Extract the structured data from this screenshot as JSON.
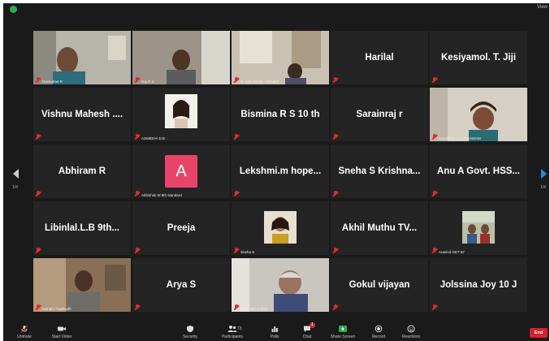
{
  "window": {
    "view_label": "View"
  },
  "colors": {
    "speaking_outline": "#b6d33a",
    "muted": "#e02b2b",
    "end": "#d6222a",
    "share_green": "#2fae4c",
    "avatar_pink": "#e8446a"
  },
  "pages": {
    "left": "1/4",
    "right": "1/4"
  },
  "tiles": [
    {
      "type": "video",
      "tag": "Ravindran R"
    },
    {
      "type": "video",
      "tag": "Raj R S"
    },
    {
      "type": "video",
      "tag": "D. Ajay kumar, Hemalat"
    },
    {
      "type": "name",
      "name": "Harilal"
    },
    {
      "type": "name",
      "name": "Kesiyamol. T. Jiji"
    },
    {
      "type": "name",
      "name": "Vishnu Mahesh ...."
    },
    {
      "type": "thumb",
      "tag": "ASMIDHA D B"
    },
    {
      "type": "name",
      "name": "Bismina R S 10 th"
    },
    {
      "type": "name",
      "name": "Sarainraj r"
    },
    {
      "type": "video",
      "tag": "SALEENA K ASHRAMAM"
    },
    {
      "type": "name",
      "name": "Abhiram R"
    },
    {
      "type": "avatar",
      "letter": "A",
      "tag": "Abhishek M 9th standard"
    },
    {
      "type": "name",
      "name": "Lekshmi.m hope..."
    },
    {
      "type": "name",
      "name": "Sneha S Krishna..."
    },
    {
      "type": "name",
      "name": "Anu A Govt. HSS..."
    },
    {
      "type": "name",
      "name": "Libinlal.L.B  9th..."
    },
    {
      "type": "name",
      "name": "Preeja"
    },
    {
      "type": "thumb",
      "tag": "Sneha S"
    },
    {
      "type": "name",
      "name": "Akhil Muthu TV..."
    },
    {
      "type": "thumb",
      "tag": "Aravind GET 87"
    },
    {
      "type": "video",
      "tag": "Mohdim Nadirudh"
    },
    {
      "type": "name",
      "name": "Arya S"
    },
    {
      "type": "video",
      "tag": "Sathyadh Kumar",
      "speaking": true
    },
    {
      "type": "name",
      "name": "Gokul vijayan"
    },
    {
      "type": "name",
      "name": "Jolssina Joy 10 J"
    }
  ],
  "toolbar": {
    "items": [
      {
        "label": "Unmute",
        "icon": "mic-muted-icon"
      },
      {
        "label": "Start Video",
        "icon": "video-icon"
      },
      {
        "label": "Security",
        "icon": "shield-icon"
      },
      {
        "label": "Participants",
        "icon": "participants-icon",
        "count": "73"
      },
      {
        "label": "Polls",
        "icon": "polls-icon"
      },
      {
        "label": "Chat",
        "icon": "chat-icon",
        "badge": "1"
      },
      {
        "label": "Share Screen",
        "icon": "share-screen-icon"
      },
      {
        "label": "Record",
        "icon": "record-icon"
      },
      {
        "label": "Reactions",
        "icon": "reactions-icon"
      }
    ],
    "end_label": "End"
  }
}
